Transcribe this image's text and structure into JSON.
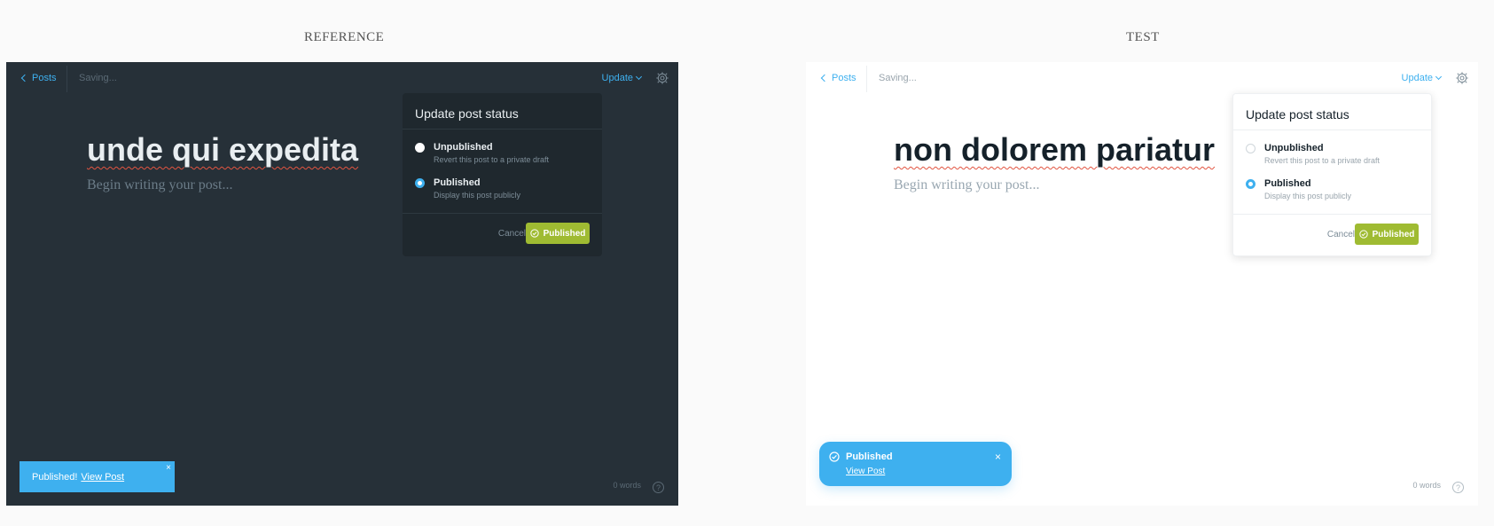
{
  "labels": {
    "reference": "REFERENCE",
    "test": "TEST"
  },
  "reference": {
    "back_label": "Posts",
    "saving": "Saving...",
    "update_label": "Update",
    "title": "unde qui expedita",
    "placeholder": "Begin writing your post...",
    "popup": {
      "title": "Update post status",
      "options": [
        {
          "label": "Unpublished",
          "description": "Revert this post to a private draft",
          "selected": false
        },
        {
          "label": "Published",
          "description": "Display this post publicly",
          "selected": true
        }
      ],
      "cancel": "Cancel",
      "confirm": "Published"
    },
    "word_count": "0 words",
    "help": "?",
    "toast": {
      "text": "Published!",
      "link": "View Post",
      "close": "×"
    }
  },
  "test": {
    "back_label": "Posts",
    "saving": "Saving...",
    "update_label": "Update",
    "title": "non dolorem pariatur",
    "placeholder": "Begin writing your post...",
    "popup": {
      "title": "Update post status",
      "options": [
        {
          "label": "Unpublished",
          "description": "Revert this post to a private draft",
          "selected": false
        },
        {
          "label": "Published",
          "description": "Display this post publicly",
          "selected": true
        }
      ],
      "cancel": "Cancel",
      "confirm": "Published"
    },
    "word_count": "0 words",
    "help": "?",
    "toast": {
      "title": "Published",
      "link": "View Post",
      "close": "×"
    }
  },
  "colors": {
    "accent": "#3eb0ef",
    "publish_green": "#9fbb32",
    "dark_bg": "#263038",
    "popup_dark": "#1f282e"
  },
  "icons": [
    "chevron-left-icon",
    "chevron-down-icon",
    "gear-icon",
    "check-circle-icon",
    "close-icon",
    "help-icon"
  ]
}
